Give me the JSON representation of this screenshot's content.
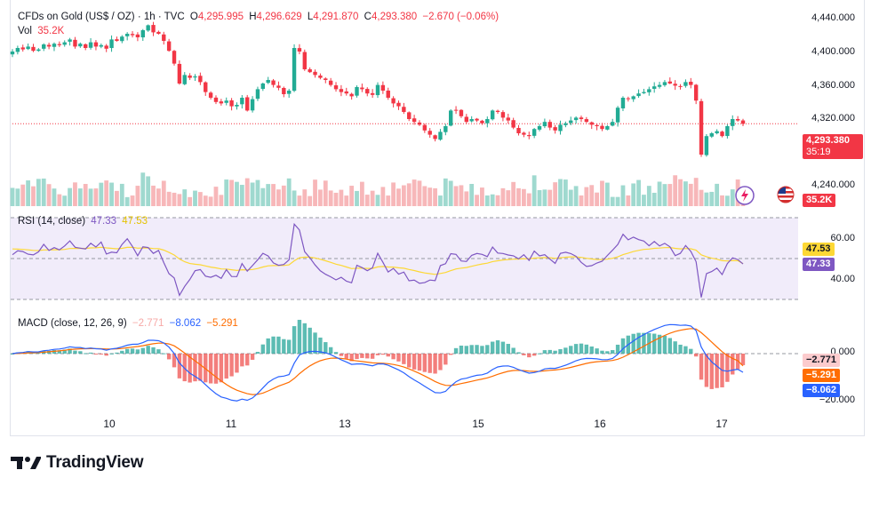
{
  "header": {
    "symbol": "CFDs on Gold (US$ / OZ) · 1h · TVC",
    "open_label": "O",
    "open": "4,295.995",
    "high_label": "H",
    "high": "4,296.629",
    "low_label": "L",
    "low": "4,291.870",
    "close_label": "C",
    "close": "4,293.380",
    "change": "−2.670 (−0.06%)",
    "vol_label": "Vol",
    "vol": "35.2K"
  },
  "rsi": {
    "label": "RSI (14, close)",
    "value": "47.33",
    "ma": "47.53"
  },
  "macd": {
    "label": "MACD (close, 12, 26, 9)",
    "hist": "−2.771",
    "macd": "−8.062",
    "signal": "−5.291"
  },
  "price_axis": [
    "4,440.000",
    "4,400.000",
    "4,360.000",
    "4,320.000",
    "4,240.000"
  ],
  "rsi_axis": [
    "60.00",
    "40.00"
  ],
  "macd_axis": [
    "0.000",
    "−20.000"
  ],
  "x_axis": [
    "10",
    "11",
    "13",
    "15",
    "16",
    "17"
  ],
  "tags": {
    "price": "4,293.380",
    "countdown": "35:19",
    "vol": "35.2K",
    "rsi_ma": "47.53",
    "rsi": "47.33",
    "hist": "−2.771",
    "signal": "−5.291",
    "macd": "−8.062"
  },
  "brand": "TradingView",
  "colors": {
    "up": "#22ab94",
    "down": "#f23645",
    "rsi": "#7e57c2",
    "rsi_ma": "#fdd835",
    "macd": "#2962ff",
    "signal": "#ff6d00",
    "hist_up": "#26a69a",
    "hist_down": "#ef5350"
  },
  "chart_data": [
    {
      "type": "candlestick",
      "title": "CFDs on Gold (US$ / OZ) · 1h · TVC",
      "x_ticks": [
        "10",
        "11",
        "13",
        "15",
        "16",
        "17"
      ],
      "ylim": [
        4230,
        4450
      ],
      "y_ticks": [
        4440,
        4400,
        4360,
        4320,
        4240
      ],
      "last_price": 4293.38,
      "close_series": [
        4395,
        4400,
        4398,
        4402,
        4396,
        4398,
        4405,
        4402,
        4406,
        4404,
        4408,
        4412,
        4402,
        4406,
        4400,
        4408,
        4402,
        4404,
        4399,
        4412,
        4410,
        4416,
        4420,
        4418,
        4415,
        4425,
        4432,
        4422,
        4420,
        4410,
        4396,
        4378,
        4350,
        4362,
        4358,
        4360,
        4352,
        4338,
        4330,
        4324,
        4322,
        4326,
        4318,
        4320,
        4330,
        4312,
        4328,
        4342,
        4350,
        4355,
        4348,
        4344,
        4335,
        4340,
        4400,
        4395,
        4370,
        4366,
        4362,
        4358,
        4355,
        4348,
        4342,
        4338,
        4336,
        4332,
        4345,
        4342,
        4336,
        4334,
        4348,
        4340,
        4330,
        4322,
        4318,
        4310,
        4300,
        4296,
        4292,
        4284,
        4278,
        4272,
        4282,
        4290,
        4312,
        4312,
        4304,
        4296,
        4300,
        4298,
        4294,
        4300,
        4312,
        4310,
        4302,
        4298,
        4288,
        4280,
        4278,
        4276,
        4286,
        4290,
        4296,
        4288,
        4284,
        4292,
        4294,
        4298,
        4302,
        4300,
        4296,
        4292,
        4290,
        4286,
        4290,
        4296,
        4316,
        4330,
        4328,
        4332,
        4336,
        4338,
        4342,
        4346,
        4348,
        4352,
        4350,
        4347,
        4346,
        4352,
        4348,
        4326,
        4250,
        4276,
        4280,
        4283,
        4276,
        4290,
        4300,
        4298,
        4293.38
      ],
      "volume": {
        "last": "35.2K"
      }
    },
    {
      "type": "line",
      "title": "RSI (14, close)",
      "y_ticks": [
        60,
        40
      ],
      "series": [
        {
          "name": "RSI",
          "last": 47.33
        },
        {
          "name": "MA",
          "last": 47.53
        }
      ]
    },
    {
      "type": "line",
      "title": "MACD (close, 12, 26, 9)",
      "y_ticks": [
        0,
        -20
      ],
      "series": [
        {
          "name": "Histogram",
          "last": -2.771
        },
        {
          "name": "MACD",
          "last": -8.062
        },
        {
          "name": "Signal",
          "last": -5.291
        }
      ]
    }
  ]
}
